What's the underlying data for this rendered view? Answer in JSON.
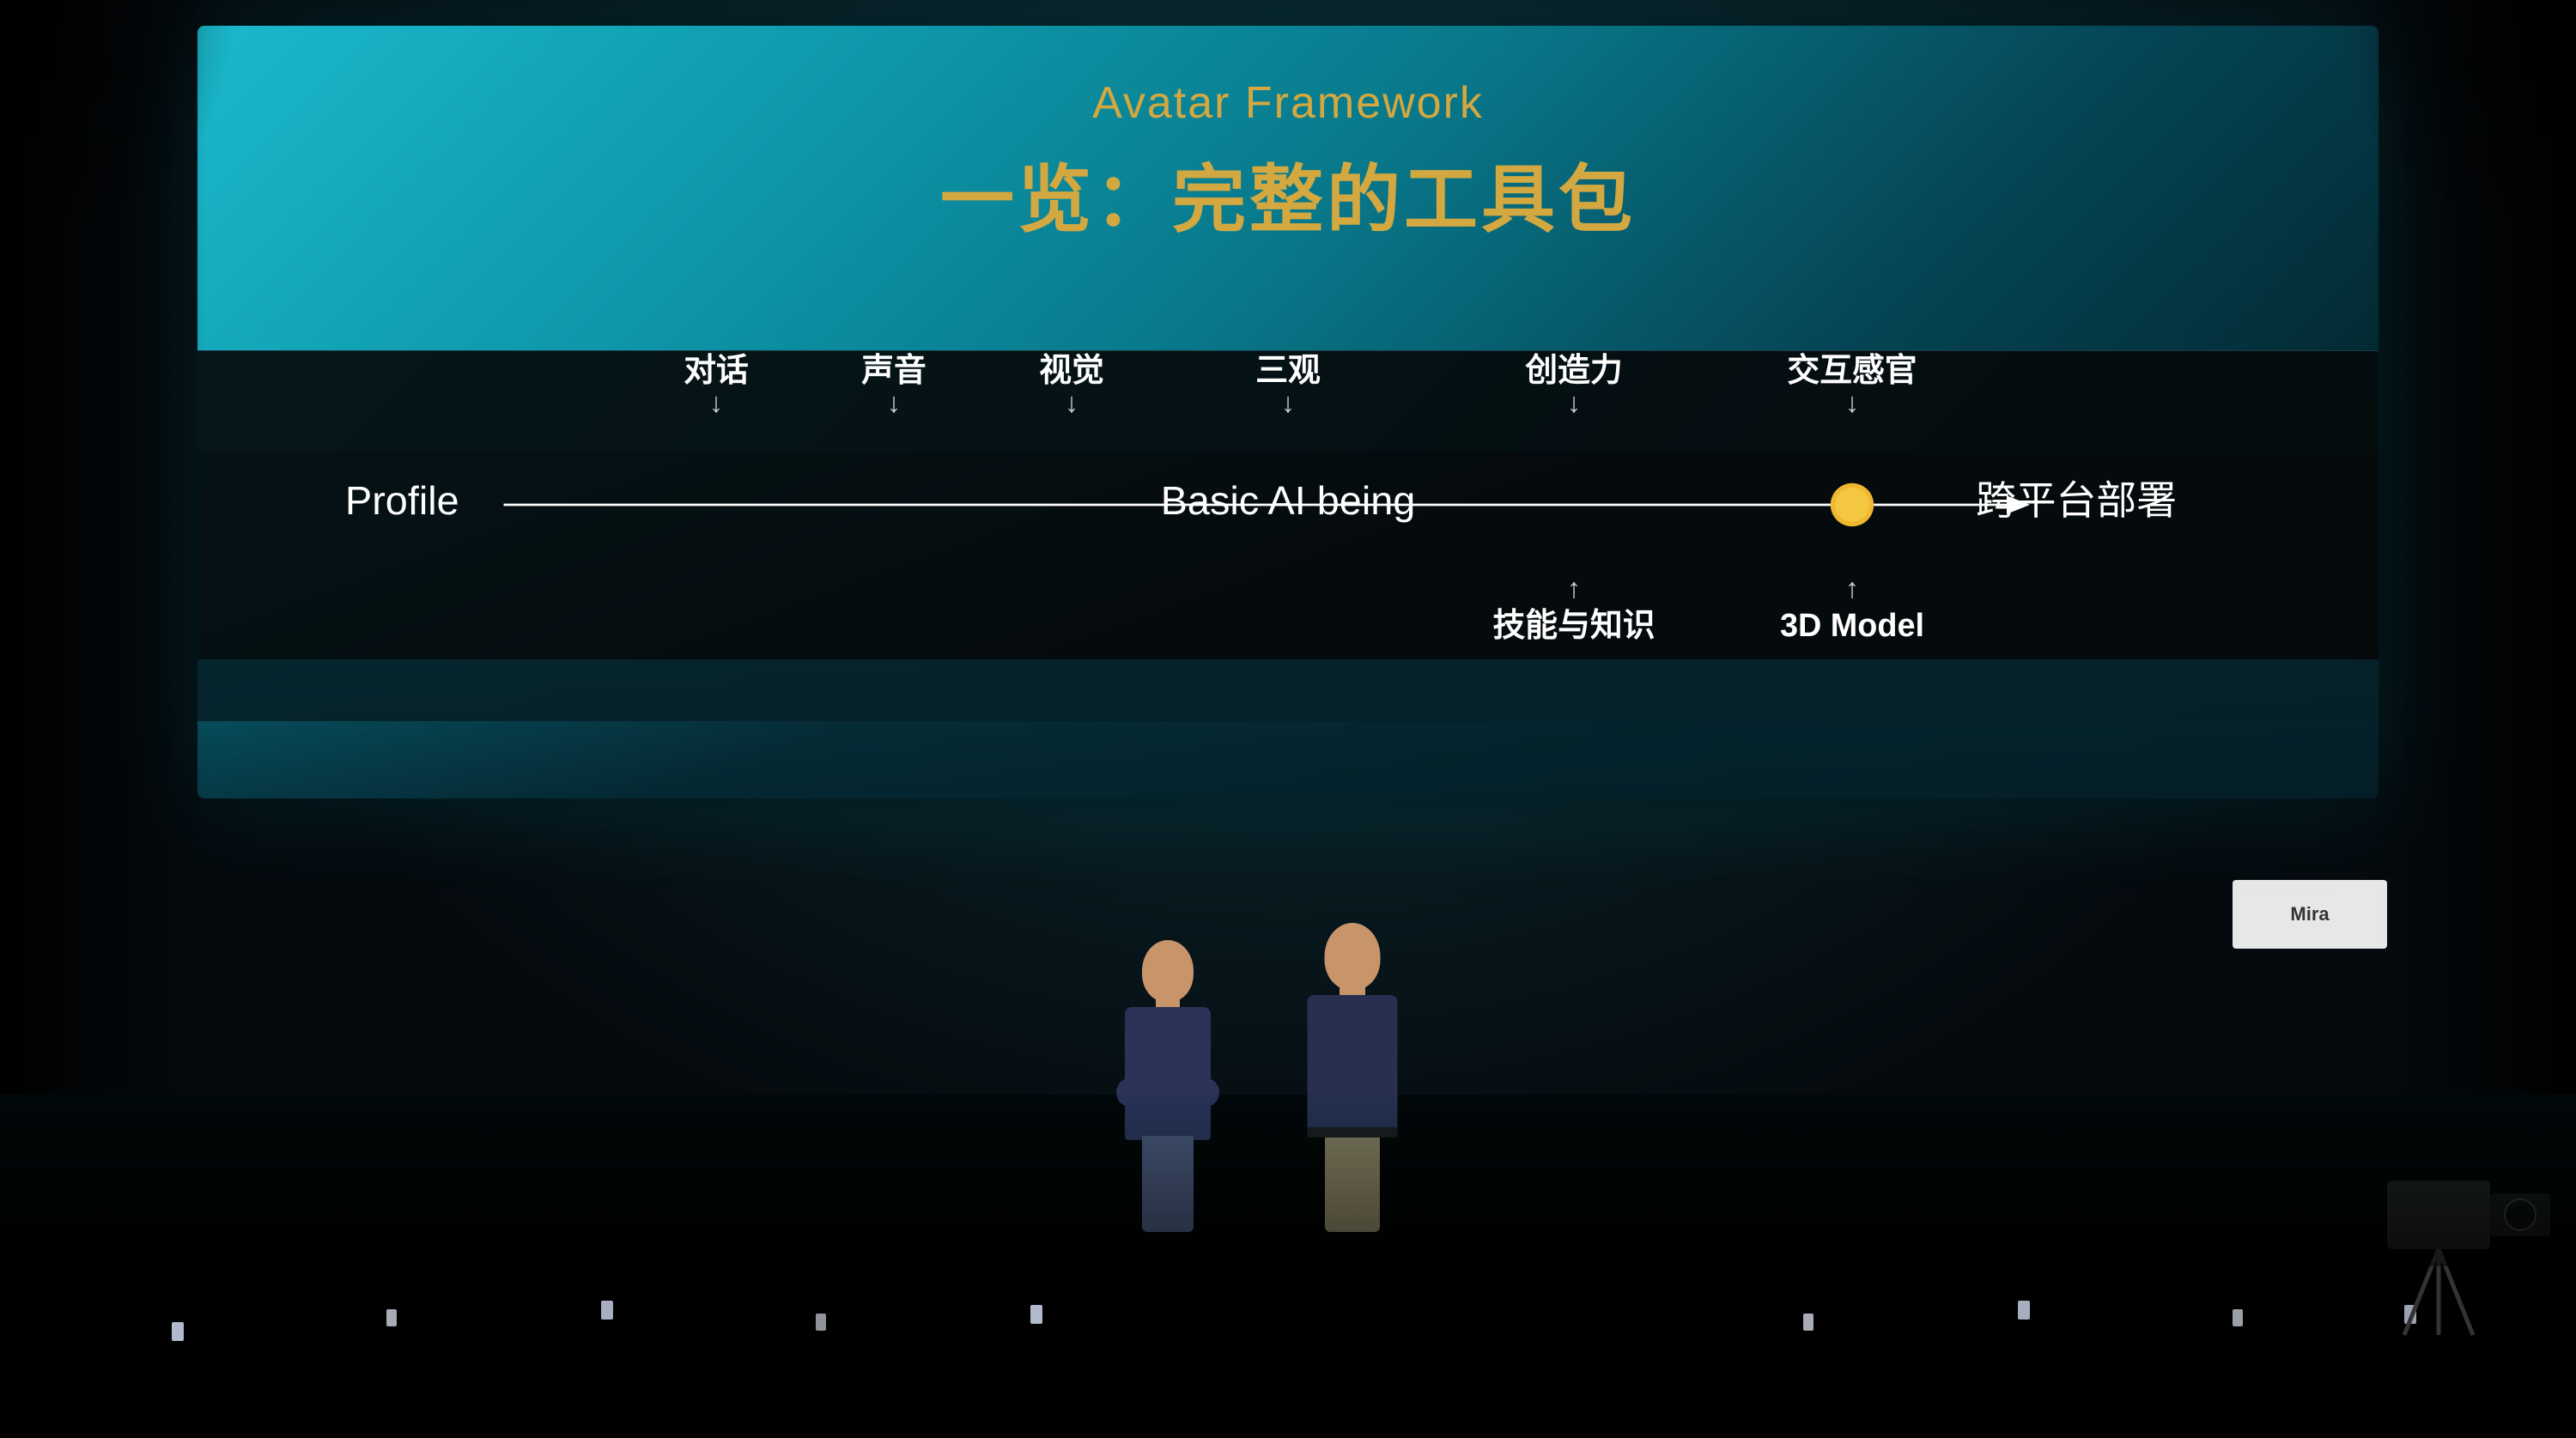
{
  "slide": {
    "title_en": "Avatar Framework",
    "title_zh": "一览：完整的工具包",
    "diagram": {
      "left_label": "Profile",
      "center_label": "Basic AI being",
      "right_label": "跨平台部署",
      "top_items": [
        {
          "label": "对话",
          "x_percent": 22
        },
        {
          "label": "声音",
          "x_percent": 33
        },
        {
          "label": "视觉",
          "x_percent": 44
        },
        {
          "label": "三观",
          "x_percent": 57
        },
        {
          "label": "创造力",
          "x_percent": 71
        },
        {
          "label": "交互感官",
          "x_percent": 83
        }
      ],
      "bottom_items": [
        {
          "label": "技能与知识",
          "x_percent": 71
        },
        {
          "label": "3D Model",
          "x_percent": 83
        }
      ],
      "node_x_percent": 83
    }
  },
  "presenters": [
    {
      "id": "left",
      "description": "Left presenter - dark polo shirt, jeans"
    },
    {
      "id": "right",
      "description": "Right presenter - dark polo shirt, khaki pants"
    }
  ],
  "info_card": {
    "text": "Mira"
  }
}
